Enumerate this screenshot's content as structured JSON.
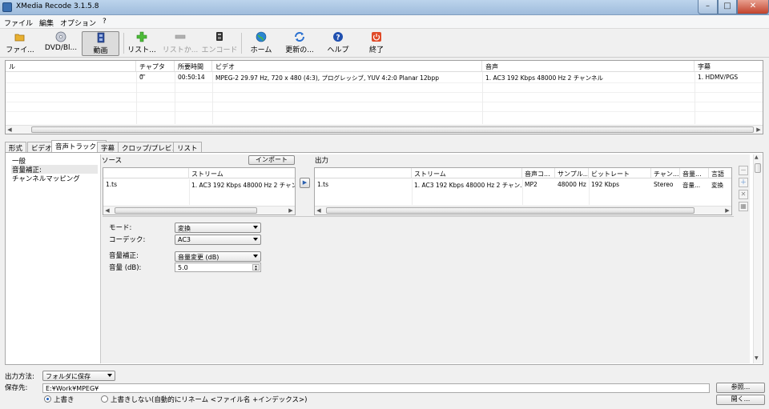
{
  "window": {
    "title": "XMedia Recode 3.1.5.8",
    "controls": {
      "minimize": "–",
      "maximize": "□",
      "close": "✕"
    }
  },
  "menubar": {
    "items": [
      "ファイル",
      "編集",
      "オプション",
      "?"
    ]
  },
  "toolbar": {
    "buttons": [
      {
        "label": "ファイ...",
        "icon": "open-file-icon",
        "color": "#e0a020"
      },
      {
        "label": "DVD/Bl...",
        "icon": "disc-icon",
        "color": "#606878"
      },
      {
        "label": "動画",
        "icon": "film-icon",
        "color": "#3050a0"
      },
      {
        "label": "リスト...",
        "icon": "plus-icon",
        "color": "#40b040"
      },
      {
        "label": "リストか...",
        "icon": "minus-icon",
        "color": "#a0a0a0"
      },
      {
        "label": "エンコード",
        "icon": "encode-icon",
        "color": "#303030"
      },
      {
        "label": "ホーム",
        "icon": "globe-icon",
        "color": "#2a70c0"
      },
      {
        "label": "更新の...",
        "icon": "refresh-icon",
        "color": "#2a70d0"
      },
      {
        "label": "ヘルプ",
        "icon": "help-icon",
        "color": "#2050b0"
      },
      {
        "label": "終了",
        "icon": "power-icon",
        "color": "#d04020"
      }
    ]
  },
  "file_list": {
    "columns": [
      "ル",
      "チャプター",
      "所要時間",
      "ビデオ",
      "音声",
      "字幕"
    ],
    "rows": [
      {
        "name": "",
        "chapter": "0",
        "duration": "00:50:14",
        "video": "MPEG-2 29.97 Hz, 720 x 480 (4:3), プログレッシブ, YUV 4:2:0 Planar 12bpp",
        "audio": "1. AC3 192 Kbps 48000 Hz 2 チャンネル",
        "subtitle": "1. HDMV/PGS"
      }
    ]
  },
  "tabs": [
    "形式",
    "ビデオ",
    "音声トラック 1",
    "字幕",
    "クロップ/プレビュー",
    "リスト"
  ],
  "nav": {
    "items": [
      "一般",
      "音量補正:",
      "チャンネルマッピング"
    ]
  },
  "source": {
    "title": "ソース",
    "import_label": "インポート",
    "columns": [
      "",
      "ストリーム"
    ],
    "rows": [
      {
        "file": "1.ts",
        "stream": "1. AC3 192 Kbps 48000 Hz 2 チャンネル"
      }
    ]
  },
  "output": {
    "title": "出力",
    "columns": [
      "",
      "ストリーム",
      "音声コ...",
      "サンプル...",
      "ビットレート",
      "チャン...",
      "音量...",
      "言語"
    ],
    "rows": [
      {
        "file": "1.ts",
        "stream": "1. AC3 192 Kbps 48000 Hz 2 チャン...",
        "codec": "MP2",
        "sample": "48000 Hz",
        "bitrate": "192 Kbps",
        "channel": "Stereo",
        "volume": "音量...",
        "lang": "変換"
      }
    ]
  },
  "settings": {
    "mode_label": "モード:",
    "mode_value": "変換",
    "codec_label": "コーデック:",
    "codec_value": "AC3",
    "normalize_label": "音量補正:",
    "normalize_value": "音量変更 (dB)",
    "volume_label": "音量 (dB):",
    "volume_value": "5.0"
  },
  "bottom": {
    "output_method_label": "出力方法:",
    "output_method_value": "フォルダに保存",
    "save_to_label": "保存先:",
    "save_path": "E:¥Work¥MPEG¥",
    "browse_label": "参照...",
    "open_label": "開く...",
    "overwrite_label": "上書き",
    "no_overwrite_label": "上書きしない(自動的にリネーム <ファイル名 +インデックス>)",
    "overwrite_selected": true
  }
}
